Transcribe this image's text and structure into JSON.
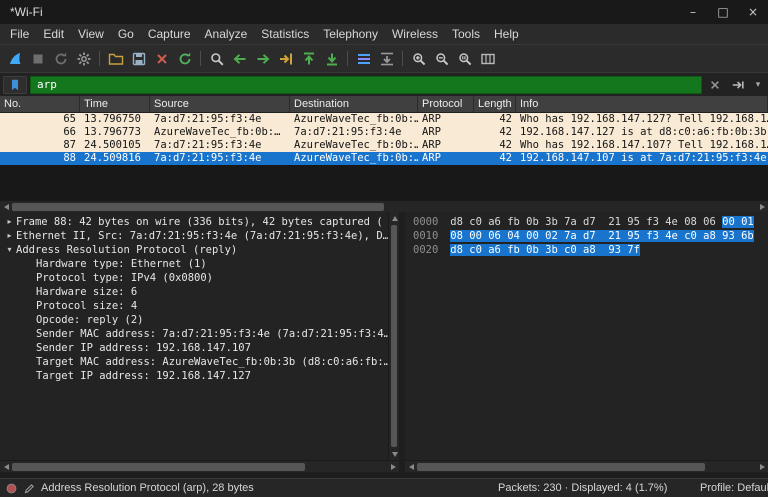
{
  "window": {
    "title": "*Wi-Fi",
    "minimize": "–",
    "maximize": "□",
    "close": "×"
  },
  "menu": {
    "items": [
      "File",
      "Edit",
      "View",
      "Go",
      "Capture",
      "Analyze",
      "Statistics",
      "Telephony",
      "Wireless",
      "Tools",
      "Help"
    ]
  },
  "toolbar": {
    "icons": [
      "start-capture",
      "stop-capture",
      "restart-capture",
      "capture-options",
      "open-file",
      "save-file",
      "close-file",
      "reload-file",
      "find-packet",
      "go-back",
      "go-forward",
      "go-to-packet",
      "go-first-packet",
      "go-last-packet",
      "colorize-packets",
      "auto-scroll",
      "zoom-in",
      "zoom-out",
      "zoom-original",
      "resize-columns"
    ]
  },
  "filter": {
    "value": "arp"
  },
  "packet_list": {
    "columns": [
      "No.",
      "Time",
      "Source",
      "Destination",
      "Protocol",
      "Length",
      "Info"
    ],
    "rows": [
      {
        "no": "65",
        "time": "13.796750",
        "source": "7a:d7:21:95:f3:4e",
        "destination": "AzureWaveTec_fb:0b:…",
        "protocol": "ARP",
        "length": "42",
        "info": "Who has 192.168.147.127? Tell 192.168.1…",
        "selected": false
      },
      {
        "no": "66",
        "time": "13.796773",
        "source": "AzureWaveTec_fb:0b:…",
        "destination": "7a:d7:21:95:f3:4e",
        "protocol": "ARP",
        "length": "42",
        "info": "192.168.147.127 is at d8:c0:a6:fb:0b:3b",
        "selected": false
      },
      {
        "no": "87",
        "time": "24.500105",
        "source": "7a:d7:21:95:f3:4e",
        "destination": "AzureWaveTec_fb:0b:…",
        "protocol": "ARP",
        "length": "42",
        "info": "Who has 192.168.147.107? Tell 192.168.1…",
        "selected": false
      },
      {
        "no": "88",
        "time": "24.509816",
        "source": "7a:d7:21:95:f3:4e",
        "destination": "AzureWaveTec_fb:0b:…",
        "protocol": "ARP",
        "length": "42",
        "info": "192.168.147.107 is at 7a:d7:21:95:f3:4e",
        "selected": true
      }
    ]
  },
  "details": {
    "lines": [
      {
        "arrow": "▸",
        "indent": 0,
        "text": "Frame 88: 42 bytes on wire (336 bits), 42 bytes captured ("
      },
      {
        "arrow": "▸",
        "indent": 0,
        "text": "Ethernet II, Src: 7a:d7:21:95:f3:4e (7a:d7:21:95:f3:4e), D…"
      },
      {
        "arrow": "▾",
        "indent": 0,
        "text": "Address Resolution Protocol (reply)"
      },
      {
        "arrow": "",
        "indent": 1,
        "text": "Hardware type: Ethernet (1)"
      },
      {
        "arrow": "",
        "indent": 1,
        "text": "Protocol type: IPv4 (0x0800)"
      },
      {
        "arrow": "",
        "indent": 1,
        "text": "Hardware size: 6"
      },
      {
        "arrow": "",
        "indent": 1,
        "text": "Protocol size: 4"
      },
      {
        "arrow": "",
        "indent": 1,
        "text": "Opcode: reply (2)"
      },
      {
        "arrow": "",
        "indent": 1,
        "text": "Sender MAC address: 7a:d7:21:95:f3:4e (7a:d7:21:95:f3:4…"
      },
      {
        "arrow": "",
        "indent": 1,
        "text": "Sender IP address: 192.168.147.107"
      },
      {
        "arrow": "",
        "indent": 1,
        "text": "Target MAC address: AzureWaveTec_fb:0b:3b (d8:c0:a6:fb:…"
      },
      {
        "arrow": "",
        "indent": 1,
        "text": "Target IP address: 192.168.147.127"
      }
    ]
  },
  "hex": {
    "rows": [
      {
        "offset": "0000",
        "plain": "d8 c0 a6 fb 0b 3b 7a d7  21 95 f3 4e 08 06 ",
        "highlight": "00 01"
      },
      {
        "offset": "0010",
        "plain": "",
        "highlight": "08 00 06 04 00 02 7a d7  21 95 f3 4e c0 a8 93 6b"
      },
      {
        "offset": "0020",
        "plain": "",
        "highlight": "d8 c0 a6 fb 0b 3b c0 a8  93 7f"
      }
    ]
  },
  "status": {
    "field_info": "Address Resolution Protocol (arp), 28 bytes",
    "packets_summary": "Packets: 230 · Displayed: 4 (1.7%)",
    "profile": "Profile: Default"
  },
  "colors": {
    "selection_blue": "#1874cd",
    "arp_row_bg": "#f8ead5",
    "filter_valid_green": "#14761d"
  }
}
